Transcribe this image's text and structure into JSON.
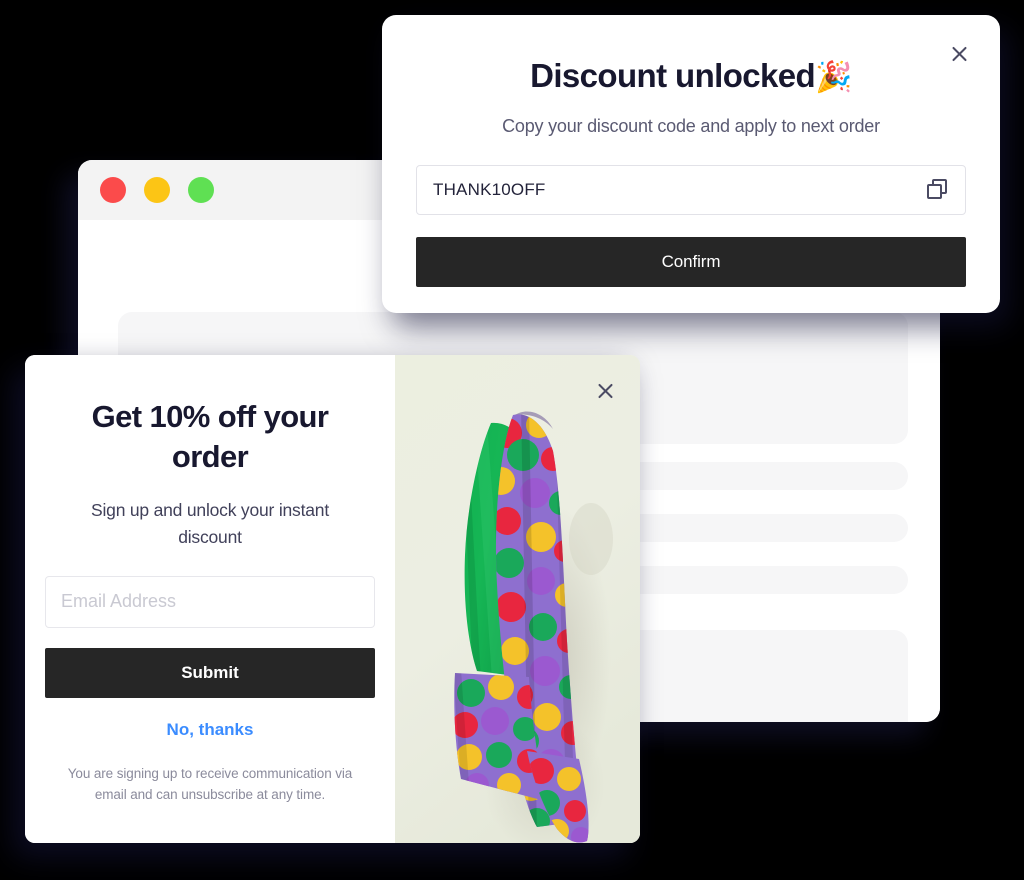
{
  "browser": {
    "name": "browser-mockup",
    "traffic_lights": [
      "red",
      "yellow",
      "green"
    ],
    "skeleton_placeholders": 5
  },
  "discount_modal": {
    "title": "Discount unlocked",
    "title_emoji": "🎉",
    "subtitle": "Copy your discount code and apply to next order",
    "code_value": "THANK10OFF",
    "copy_icon": "copy-icon",
    "confirm_label": "Confirm",
    "close_icon": "close-icon"
  },
  "signup_popup": {
    "title": "Get 10% off your order",
    "subtitle": "Sign up and unlock your instant discount",
    "email_placeholder": "Email Address",
    "email_value": "",
    "submit_label": "Submit",
    "decline_label": "No, thanks",
    "fine_print": "You are signing up to receive communication via email and can unsubscribe at any time.",
    "close_icon": "close-icon",
    "image_alt": "green-floral-jacket-on-hook"
  },
  "colors": {
    "page_background": "#000000",
    "button_dark": "#262626",
    "link_blue": "#3b8cff",
    "heading_navy": "#18182f",
    "body_gray": "#5a5a72",
    "fine_print_gray": "#8b8b9c",
    "image_panel_bg": "#ebeede",
    "skeleton_gray": "#f6f6f7",
    "traffic_red": "#fb4b4b",
    "traffic_yellow": "#fcc515",
    "traffic_green": "#5fe053"
  }
}
